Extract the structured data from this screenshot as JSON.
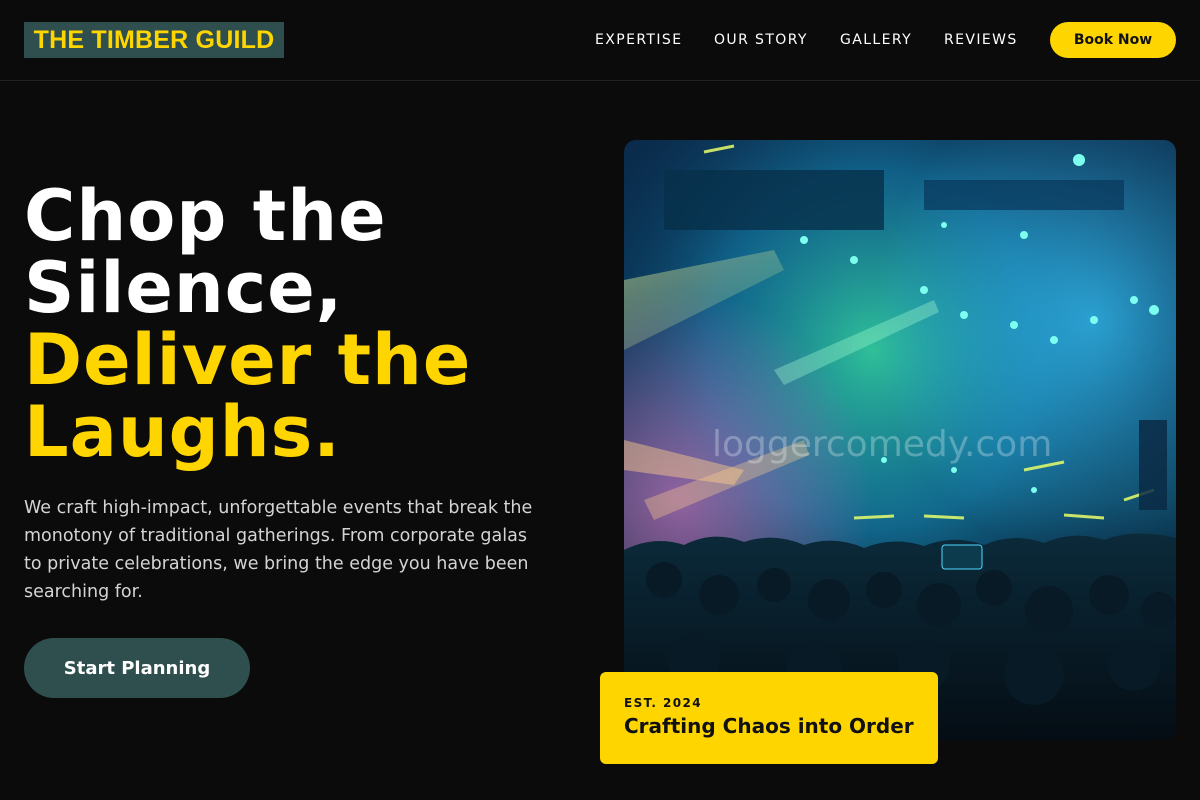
{
  "header": {
    "brand": "THE TIMBER GUILD",
    "nav": [
      "EXPERTISE",
      "OUR STORY",
      "GALLERY",
      "REVIEWS"
    ],
    "cta_label": "Book Now"
  },
  "hero": {
    "title_lines_white": [
      "Chop the",
      "Silence,"
    ],
    "title_lines_yellow": [
      "Deliver the",
      "Laughs."
    ],
    "description": "We craft high-impact, unforgettable events that break the monotony of traditional gatherings. From corporate galas to private celebrations, we bring the edge you have been searching for.",
    "cta_label": "Start Planning"
  },
  "image": {
    "watermark": "loggercomedy.com"
  },
  "badge": {
    "label": "EST. 2024",
    "title": "Crafting Chaos into Order"
  },
  "colors": {
    "accent": "#ffd500",
    "teal": "#2f4f4f",
    "background": "#0b0b0b"
  }
}
